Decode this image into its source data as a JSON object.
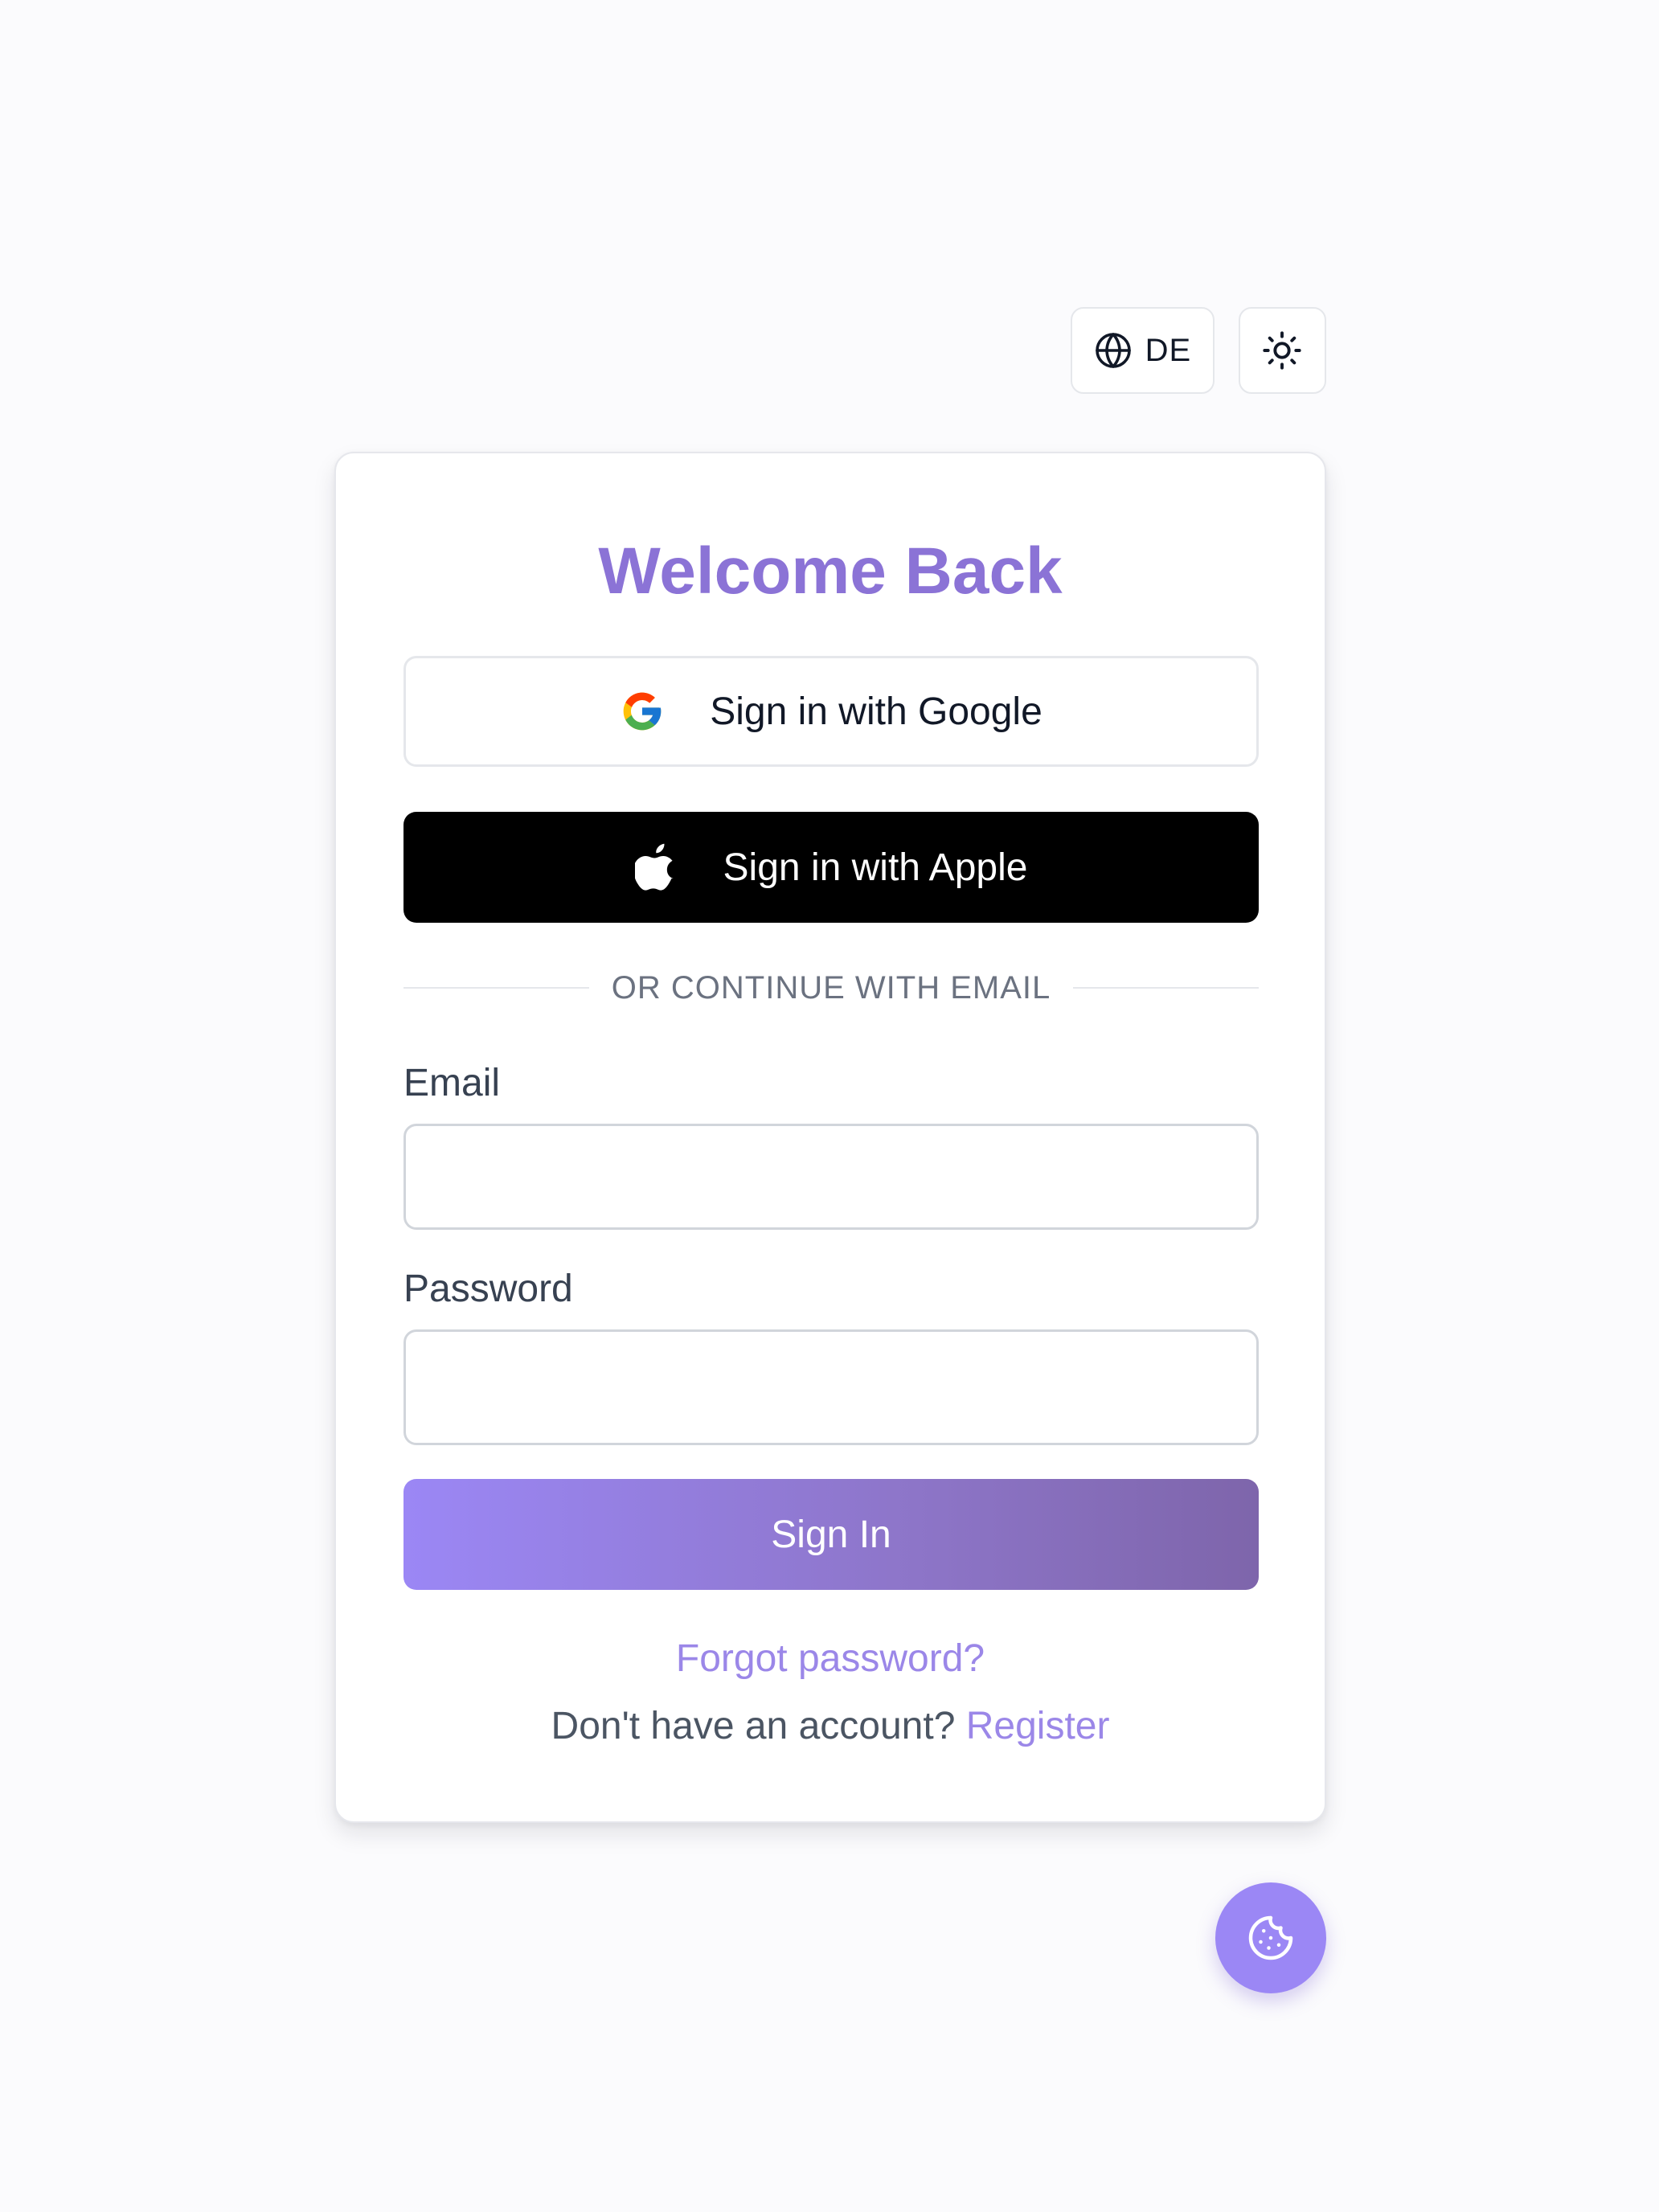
{
  "header": {
    "language_label": "DE",
    "language_icon": "globe-icon",
    "theme_icon": "sun-icon"
  },
  "card": {
    "title": "Welcome Back",
    "google_label": "Sign in with Google",
    "apple_label": "Sign in with Apple",
    "divider_text": "OR CONTINUE WITH EMAIL",
    "email_label": "Email",
    "email_value": "",
    "password_label": "Password",
    "password_value": "",
    "signin_label": "Sign In",
    "forgot_label": "Forgot password?",
    "register_prompt": "Don't have an account? ",
    "register_label": "Register"
  },
  "fab": {
    "icon": "cookie-icon"
  },
  "colors": {
    "accent": "#9b87f5",
    "title": "#8b73d6",
    "link": "#9b87e8",
    "apple_button": "#000000",
    "background": "#fbfbfd"
  }
}
